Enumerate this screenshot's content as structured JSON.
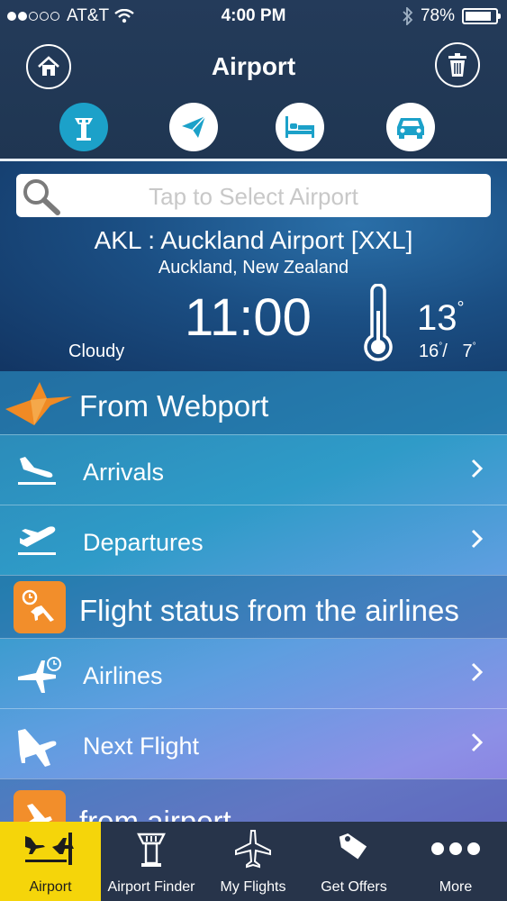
{
  "status": {
    "carrier": "AT&T",
    "time": "4:00 PM",
    "battery": "78%"
  },
  "header": {
    "title": "Airport"
  },
  "categories": [
    "airport-tower-icon",
    "paper-plane-icon",
    "bed-icon",
    "car-icon"
  ],
  "search": {
    "placeholder": "Tap to Select Airport"
  },
  "airport": {
    "name": "AKL : Auckland Airport [XXL]",
    "city": "Auckland, New Zealand"
  },
  "clock": "11:00",
  "weather": {
    "condition": "Cloudy",
    "temp": "13",
    "high": "16",
    "low": "7"
  },
  "list": {
    "section1": "From Webport",
    "arrivals": "Arrivals",
    "departures": "Departures",
    "section2": "Flight status from the airlines",
    "airlines": "Airlines",
    "next_flight": "Next Flight",
    "section3": "from airport"
  },
  "tabs": [
    {
      "label": "Airport"
    },
    {
      "label": "Airport Finder"
    },
    {
      "label": "My Flights"
    },
    {
      "label": "Get Offers"
    },
    {
      "label": "More"
    }
  ],
  "colors": {
    "accent": "#1ca1c9",
    "tab_active": "#f5d50a",
    "orange": "#f28e2b"
  }
}
